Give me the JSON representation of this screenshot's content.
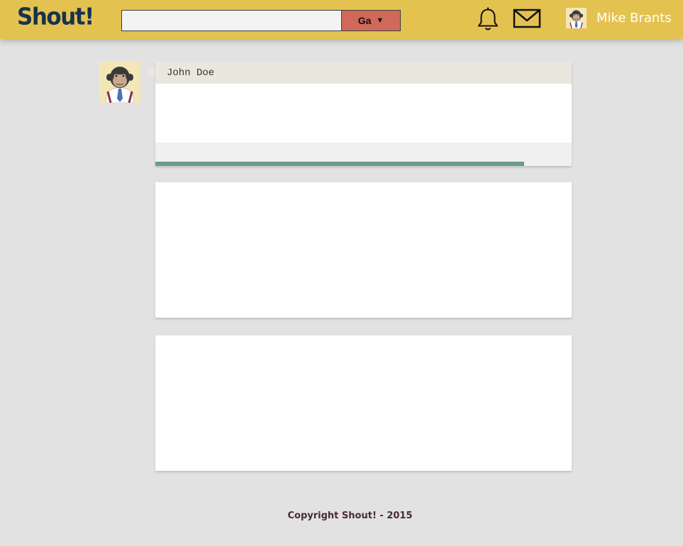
{
  "header": {
    "logo": "Shout!",
    "search": {
      "value": "",
      "placeholder": ""
    },
    "search_scope": "Ga",
    "user": {
      "name": "Mike Brants"
    },
    "icons": [
      "bell-icon",
      "mail-icon"
    ],
    "colors": {
      "bar": "#e4c250",
      "logo": "#17324f",
      "select": "#d0695a"
    }
  },
  "feed": {
    "posts": [
      {
        "author": "John Doe",
        "progress": 0.886
      }
    ]
  },
  "footer": {
    "text": "Copyright Shout! - 2015"
  }
}
